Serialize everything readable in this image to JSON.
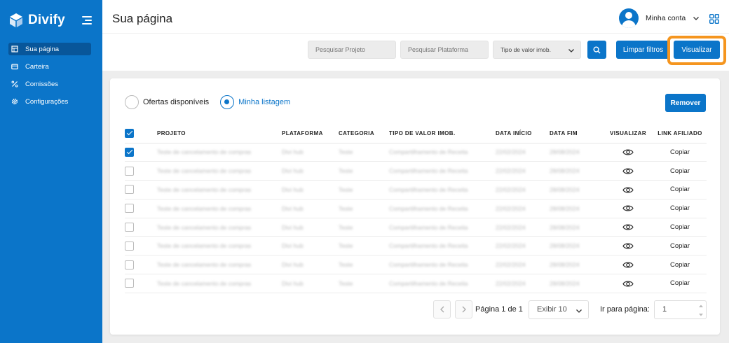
{
  "brand": {
    "name": "Divify"
  },
  "sidebar": {
    "items": [
      {
        "label": "Sua página",
        "icon": "page-icon",
        "active": true
      },
      {
        "label": "Carteira",
        "icon": "wallet-icon",
        "active": false
      },
      {
        "label": "Comissões",
        "icon": "percent-icon",
        "active": false
      },
      {
        "label": "Configurações",
        "icon": "gear-icon",
        "active": false
      }
    ]
  },
  "header": {
    "title": "Sua página",
    "account_label": "Minha conta"
  },
  "filters": {
    "project_placeholder": "Pesquisar Projeto",
    "platform_placeholder": "Pesquisar Plataforma",
    "value_type_selected": "Tipo de valor imob.",
    "clear_label": "Limpar filtros",
    "view_label": "Visualizar"
  },
  "listing": {
    "options": [
      {
        "label": "Ofertas disponíveis",
        "checked": false
      },
      {
        "label": "Minha listagem",
        "checked": true
      }
    ],
    "remove_label": "Remover"
  },
  "table": {
    "columns": [
      "PROJETO",
      "PLATAFORMA",
      "CATEGORIA",
      "TIPO DE VALOR IMOB.",
      "DATA INÍCIO",
      "DATA FIM",
      "VISUALIZAR",
      "LINK AFILIADO"
    ],
    "rows": [
      {
        "checked": true,
        "projeto": "Teste de cancelamento de compras",
        "plataforma": "Divi hub",
        "categoria": "Teste",
        "tipo": "Compartilhamento de Receita",
        "inicio": "22/02/2024",
        "fim": "28/08/2024",
        "link": "Copiar"
      },
      {
        "checked": false,
        "projeto": "Teste de cancelamento de compras",
        "plataforma": "Divi hub",
        "categoria": "Teste",
        "tipo": "Compartilhamento de Receita",
        "inicio": "22/02/2024",
        "fim": "28/08/2024",
        "link": "Copiar"
      },
      {
        "checked": false,
        "projeto": "Teste de cancelamento de compras",
        "plataforma": "Divi hub",
        "categoria": "Teste",
        "tipo": "Compartilhamento de Receita",
        "inicio": "22/02/2024",
        "fim": "28/08/2024",
        "link": "Copiar"
      },
      {
        "checked": false,
        "projeto": "Teste de cancelamento de compras",
        "plataforma": "Divi hub",
        "categoria": "Teste",
        "tipo": "Compartilhamento de Receita",
        "inicio": "22/02/2024",
        "fim": "28/08/2024",
        "link": "Copiar"
      },
      {
        "checked": false,
        "projeto": "Teste de cancelamento de compras",
        "plataforma": "Divi hub",
        "categoria": "Teste",
        "tipo": "Compartilhamento de Receita",
        "inicio": "22/02/2024",
        "fim": "28/08/2024",
        "link": "Copiar"
      },
      {
        "checked": false,
        "projeto": "Teste de cancelamento de compras",
        "plataforma": "Divi hub",
        "categoria": "Teste",
        "tipo": "Compartilhamento de Receita",
        "inicio": "22/02/2024",
        "fim": "28/08/2024",
        "link": "Copiar"
      },
      {
        "checked": false,
        "projeto": "Teste de cancelamento de compras",
        "plataforma": "Divi hub",
        "categoria": "Teste",
        "tipo": "Compartilhamento de Receita",
        "inicio": "22/02/2024",
        "fim": "28/08/2024",
        "link": "Copiar"
      },
      {
        "checked": false,
        "projeto": "Teste de cancelamento de compras",
        "plataforma": "Divi hub",
        "categoria": "Teste",
        "tipo": "Compartilhamento de Receita",
        "inicio": "22/02/2024",
        "fim": "28/08/2024",
        "link": "Copiar"
      }
    ]
  },
  "pagination": {
    "page_label": "Página 1 de 1",
    "page_size_selected": "Exibir 10",
    "goto_label": "Ir para página:",
    "goto_value": "1"
  },
  "colors": {
    "primary": "#0b75c9",
    "sidebar_active": "#08569a",
    "highlight": "#f5951e"
  }
}
